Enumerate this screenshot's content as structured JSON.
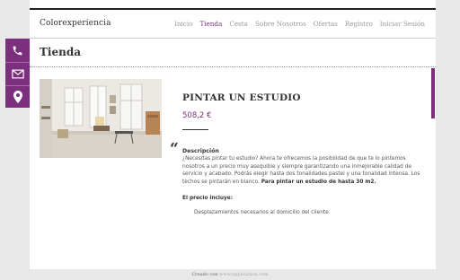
{
  "brand": "Colorexperiencia",
  "nav": {
    "items": [
      "Inicio",
      "Tienda",
      "Cesta",
      "Sobre Nosotros",
      "Ofertas",
      "Registro",
      "Iniciar Sesión"
    ],
    "active": "Tienda"
  },
  "page_title": "Tienda",
  "side_buttons": [
    {
      "icon": "phone-icon"
    },
    {
      "icon": "mail-icon"
    },
    {
      "icon": "location-pin-icon"
    }
  ],
  "product": {
    "title": "PINTAR UN ESTUDIO",
    "price": "508,2 €",
    "description_heading": "Descripción",
    "description": "¿Necesitas pintar tu estudio? Ahora te ofrecemos la posibilidad de que te lo pintemos nosotros a un precio muy asequible y siempre garantizando una inmejorable calidad de servicio y acabado. Podrás elegir hasta dos tonalidades pastel y una tonalidad intensa. Los techos se pintarán en blanco.",
    "description_bold": "Para pintar un estudio de hasta 30 m2.",
    "includes_heading": "El precio incluye:",
    "includes_items": [
      "Desplazamientos necesarios al domicilio del cliente."
    ]
  },
  "footer": {
    "prefix": "Creado con",
    "link": "www.upplication.com"
  },
  "colors": {
    "accent": "#7b2f7d",
    "background": "#e8e8e8",
    "text": "#333333"
  }
}
